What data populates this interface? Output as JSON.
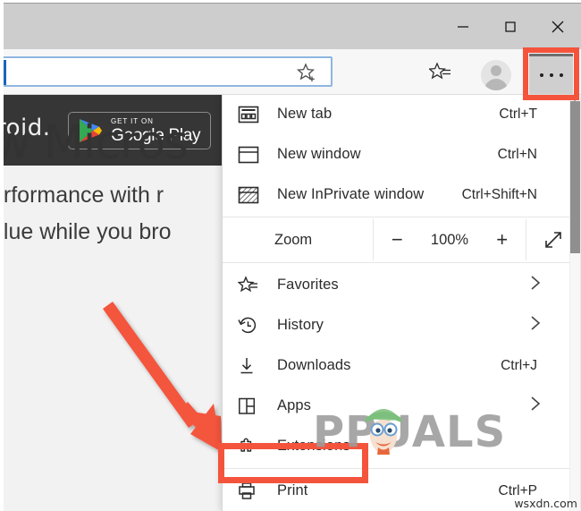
{
  "window": {
    "controls": [
      {
        "name": "minimize",
        "glyph": "minimize-icon"
      },
      {
        "name": "maximize",
        "glyph": "maximize-icon"
      },
      {
        "name": "close",
        "glyph": "close-icon"
      }
    ]
  },
  "toolbar": {
    "address_value": "",
    "address_placeholder": "",
    "favorites_icon": "star-plus-icon",
    "collections_icon": "collections-icon",
    "profile_icon": "avatar-icon",
    "settings_more_icon": "ellipsis-icon",
    "highlight_color": "#f4543c"
  },
  "page": {
    "banner_text": "roid.",
    "google_play": {
      "small": "GET IT ON",
      "big": "Google Play"
    },
    "headline": "w Micros",
    "sub1": "erformance with r",
    "sub2": "alue while you bro"
  },
  "menu": {
    "items": [
      {
        "label": "New tab",
        "shortcut": "Ctrl+T",
        "icon": "new-tab-icon",
        "chevron": false
      },
      {
        "label": "New window",
        "shortcut": "Ctrl+N",
        "icon": "new-window-icon",
        "chevron": false
      },
      {
        "label": "New InPrivate window",
        "shortcut": "Ctrl+Shift+N",
        "icon": "inprivate-window-icon",
        "chevron": false
      }
    ],
    "zoom": {
      "label": "Zoom",
      "minus": "−",
      "value": "100%",
      "plus": "+",
      "fullscreen_icon": "fullscreen-icon"
    },
    "items2": [
      {
        "label": "Favorites",
        "shortcut": "",
        "icon": "favorites-icon",
        "chevron": true
      },
      {
        "label": "History",
        "shortcut": "",
        "icon": "history-icon",
        "chevron": true
      },
      {
        "label": "Downloads",
        "shortcut": "Ctrl+J",
        "icon": "downloads-icon",
        "chevron": false
      },
      {
        "label": "Apps",
        "shortcut": "",
        "icon": "apps-icon",
        "chevron": true
      },
      {
        "label": "Extensions",
        "shortcut": "",
        "icon": "extensions-icon",
        "chevron": false
      },
      {
        "label": "Print",
        "shortcut": "Ctrl+P",
        "icon": "print-icon",
        "chevron": false
      }
    ],
    "highlight_color": "#f4543c"
  },
  "watermark": {
    "brand": "PPUALS",
    "brand_lead": "A",
    "site": "wsxdn.com"
  }
}
